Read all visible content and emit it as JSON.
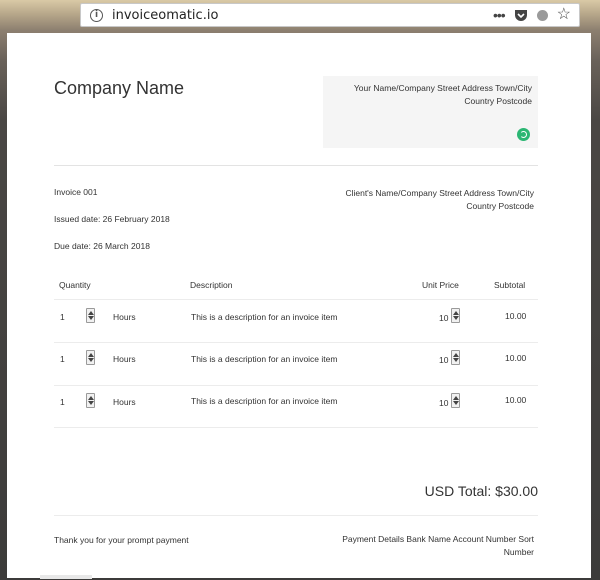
{
  "browser": {
    "url": "invoiceomatic.io",
    "icons": {
      "info": "info-icon",
      "menu": "more-dots-icon",
      "pocket": "pocket-icon",
      "status": "circle-icon",
      "bookmark": "star-icon"
    }
  },
  "invoice": {
    "company_name": "Company Name",
    "sender_address": "Your Name/Company Street Address Town/City Country Postcode",
    "invoice_number": "Invoice 001",
    "issued_date": "Issued date: 26 February 2018",
    "due_date": "Due date: 26 March 2018",
    "client_address": "Client's Name/Company Street Address Town/City Country Postcode",
    "columns": {
      "quantity": "Quantity",
      "description": "Description",
      "unit_price": "Unit Price",
      "subtotal": "Subtotal"
    },
    "items": [
      {
        "quantity": "1",
        "unit": "Hours",
        "description": "This is a description for an invoice item",
        "unit_price": "10",
        "subtotal": "10.00"
      },
      {
        "quantity": "1",
        "unit": "Hours",
        "description": "This is a description for an invoice item",
        "unit_price": "10",
        "subtotal": "10.00"
      },
      {
        "quantity": "1",
        "unit": "Hours",
        "description": "This is a description for an invoice item",
        "unit_price": "10",
        "subtotal": "10.00"
      }
    ],
    "total": "USD Total: $30.00",
    "footer_note": "Thank you for your prompt payment",
    "payment_details": "Payment Details Bank Name Account Number Sort Number"
  },
  "colors": {
    "accent_green": "#2bb673",
    "page_bg": "#ffffff",
    "sender_box_bg": "#f5f5f5"
  }
}
